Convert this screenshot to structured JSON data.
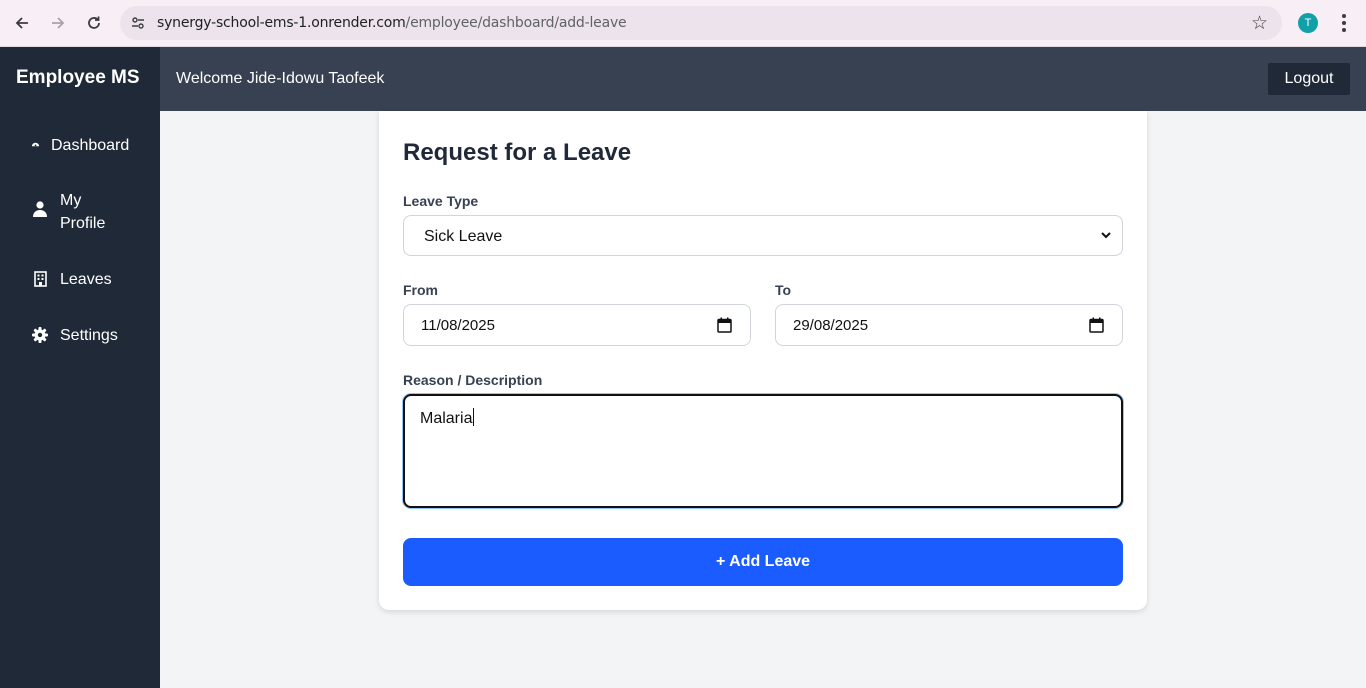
{
  "browser": {
    "url_host": "synergy-school-ems-1.onrender.com",
    "url_path": "/employee/dashboard/add-leave",
    "profile_initial": "T"
  },
  "header": {
    "brand": "Employee MS",
    "welcome": "Welcome Jide-Idowu Taofeek",
    "logout_label": "Logout"
  },
  "sidebar": {
    "items": [
      {
        "label": "Dashboard",
        "icon": "dashboard-icon"
      },
      {
        "label": "My Profile",
        "icon": "user-icon"
      },
      {
        "label": "Leaves",
        "icon": "building-icon"
      },
      {
        "label": "Settings",
        "icon": "gear-icon"
      }
    ]
  },
  "form": {
    "title": "Request for a Leave",
    "leave_type_label": "Leave Type",
    "leave_type_value": "Sick Leave",
    "from_label": "From",
    "from_value": "11/08/2025",
    "to_label": "To",
    "to_value": "29/08/2025",
    "reason_label": "Reason / Description",
    "reason_value": "Malaria",
    "submit_label": "+ Add Leave"
  },
  "colors": {
    "sidebar_bg": "#1f2937",
    "header_bg": "#374151",
    "primary_button": "#1a5cff"
  }
}
